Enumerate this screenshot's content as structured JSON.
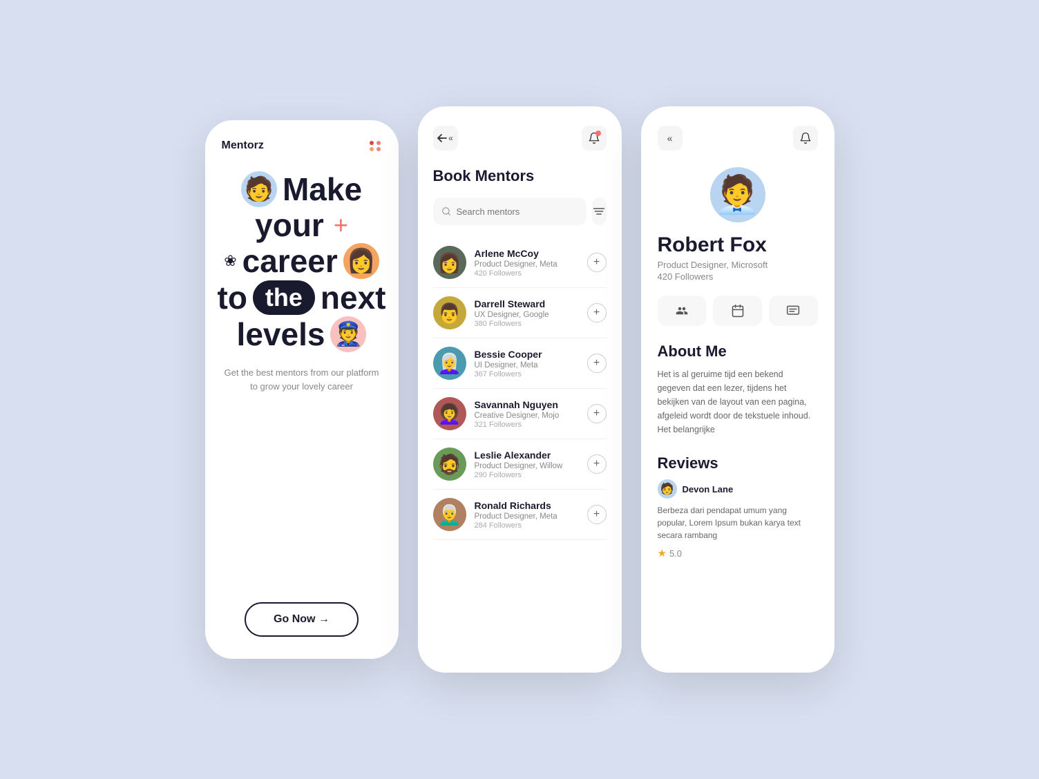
{
  "screen1": {
    "logo": "Mentorz",
    "hero": {
      "line1_word": "Make",
      "line2_word": "your",
      "line2_plus": "+",
      "line3_flower": "❀",
      "line3_word": "career",
      "line4_to": "to",
      "line4_the": "the",
      "line4_next": "next",
      "line5_word": "levels"
    },
    "tagline": "Get the best mentors from our platform to\ngrow your lovely career",
    "cta_label": "Go Now →"
  },
  "screen2": {
    "title": "Book Mentors",
    "search_placeholder": "Search mentors",
    "mentors": [
      {
        "name": "Arlene McCoy",
        "role": "Product Designer, Meta",
        "followers": "420 Followers"
      },
      {
        "name": "Darrell Steward",
        "role": "UX Designer, Google",
        "followers": "380 Followers"
      },
      {
        "name": "Bessie Cooper",
        "role": "UI Designer, Meta",
        "followers": "367 Followers"
      },
      {
        "name": "Savannah Nguyen",
        "role": "Creative Designer, Mojo",
        "followers": "321 Followers"
      },
      {
        "name": "Leslie Alexander",
        "role": "Product Designer, Willow",
        "followers": "290 Followers"
      },
      {
        "name": "Ronald Richards",
        "role": "Product Designer, Meta",
        "followers": "284 Followers"
      }
    ]
  },
  "screen3": {
    "name": "Robert Fox",
    "role": "Product Designer, Microsoft",
    "followers": "420 Followers",
    "about_title": "About Me",
    "about_text": "Het is al geruime tijd een bekend gegeven dat een lezer, tijdens het bekijken van de layout van een pagina, afgeleid wordt door de tekstuele inhoud. Het belangrijke",
    "reviews_title": "Reviews",
    "review": {
      "reviewer_name": "Devon Lane",
      "review_text": "Berbeza dari pendapat umum yang popular, Lorem Ipsum bukan karya text secara rambang",
      "rating": "5.0"
    }
  }
}
